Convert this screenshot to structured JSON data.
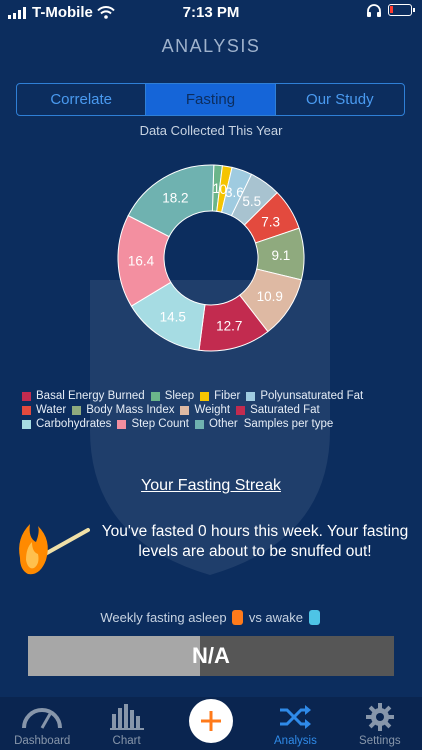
{
  "status_bar": {
    "carrier": "T-Mobile",
    "time": "7:13 PM"
  },
  "page": {
    "title": "ANALYSIS"
  },
  "tabs": [
    {
      "label": "Correlate",
      "active": false
    },
    {
      "label": "Fasting",
      "active": true
    },
    {
      "label": "Our Study",
      "active": false
    }
  ],
  "chart": {
    "subtitle": "Data Collected This Year"
  },
  "chart_data": {
    "type": "pie",
    "title": "Data Collected This Year",
    "series": [
      {
        "name": "Sleep",
        "value": 1.5,
        "label": "1",
        "color": "#6bb58a"
      },
      {
        "name": "Fiber",
        "value": 1.7,
        "label": "0",
        "color": "#f5c400"
      },
      {
        "name": "Polyunsaturated Fat",
        "value": 3.6,
        "label": "3.6",
        "color": "#9fcbe0"
      },
      {
        "name": "Basal Energy Burned",
        "value": 5.5,
        "label": "5.5",
        "color": "#a8c3d0"
      },
      {
        "name": "Water",
        "value": 7.3,
        "label": "7.3",
        "color": "#e34a3e"
      },
      {
        "name": "Body Mass Index",
        "value": 9.1,
        "label": "9.1",
        "color": "#8faa7e"
      },
      {
        "name": "Weight",
        "value": 10.9,
        "label": "10.9",
        "color": "#deb9a3"
      },
      {
        "name": "Saturated Fat",
        "value": 12.7,
        "label": "12.7",
        "color": "#c22b4f"
      },
      {
        "name": "Carbohydrates",
        "value": 14.5,
        "label": "14.5",
        "color": "#a6dce3"
      },
      {
        "name": "Step Count",
        "value": 16.4,
        "label": "16.4",
        "color": "#f38fa0"
      },
      {
        "name": "Other",
        "value": 18.2,
        "label": "18.2",
        "color": "#6fb2b0"
      }
    ]
  },
  "legend": {
    "rows": [
      [
        {
          "label": "Basal Energy Burned",
          "color": "#c22b4f"
        },
        {
          "label": "Sleep",
          "color": "#6bb58a"
        },
        {
          "label": "Fiber",
          "color": "#f5c400"
        },
        {
          "label": "Polyunsaturated Fat",
          "color": "#9fcbe0"
        }
      ],
      [
        {
          "label": "Water",
          "color": "#e34a3e"
        },
        {
          "label": "Body Mass Index",
          "color": "#8faa7e"
        },
        {
          "label": "Weight",
          "color": "#deb9a3"
        },
        {
          "label": "Saturated Fat",
          "color": "#c22b4f"
        }
      ],
      [
        {
          "label": "Carbohydrates",
          "color": "#a6dce3"
        },
        {
          "label": "Step Count",
          "color": "#f38fa0"
        },
        {
          "label": "Other",
          "color": "#6fb2b0"
        },
        {
          "label": "Samples per type",
          "color": ""
        }
      ]
    ]
  },
  "streak": {
    "title": "Your Fasting Streak",
    "message": "You've fasted 0 hours this week. Your fasting levels are about to be snuffed out!"
  },
  "weekly": {
    "prefix": "Weekly fasting asleep",
    "middle": "vs awake",
    "asleep_color": "#ff7a1a",
    "awake_color": "#4ec4e6",
    "value_text": "N/A",
    "asleep_fraction": 0.47
  },
  "tabbar": {
    "items": [
      {
        "label": "Dashboard",
        "icon": "gauge-icon",
        "active": false
      },
      {
        "label": "Chart",
        "icon": "bar-chart-icon",
        "active": false
      },
      {
        "label": "",
        "icon": "plus-icon",
        "active": false
      },
      {
        "label": "Analysis",
        "icon": "shuffle-icon",
        "active": true
      },
      {
        "label": "Settings",
        "icon": "gear-icon",
        "active": false
      }
    ]
  },
  "colors": {
    "background": "#0c2d5e",
    "accent": "#1565d8",
    "plus": "#ff7a1a"
  }
}
